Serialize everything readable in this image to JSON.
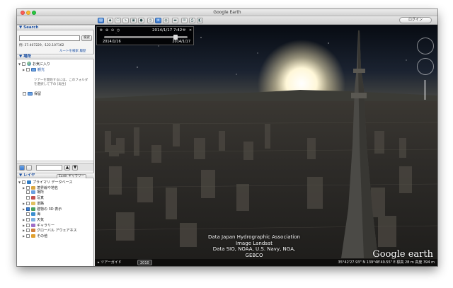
{
  "window": {
    "title": "Google Earth"
  },
  "toolbar": {
    "login_label": "ログイン"
  },
  "sidebar": {
    "search_title": "Search",
    "search_button": "検索",
    "coords": "例: 37.407229, -122.107162",
    "route_link": "ルートを検索",
    "history_link": "履歴",
    "places_title": "場所",
    "places": {
      "favorites": "お気に入り",
      "sightseeing": "観光",
      "hint": "ツアーを開始するには、このフォルダを選択して下の [再生]",
      "saved": "保留"
    },
    "layers_title": "レイヤ",
    "gallery_label": "Earth ギャラリー",
    "layers": [
      "プライマリ データベース",
      "境界線や地名",
      "場所",
      "写真",
      "道路",
      "建物の 3D 表示",
      "海",
      "天気",
      "ギャラリー",
      "グローバル アウェアネス",
      "その他"
    ],
    "layer_checked": [
      false,
      false,
      false,
      false,
      false,
      true,
      false,
      false,
      false,
      false,
      false
    ]
  },
  "time_slider": {
    "current": "2014/1/17   7:42",
    "start": "2014/1/16",
    "end": "2014/1/17",
    "position": 0.86
  },
  "map": {
    "attribution": [
      "Data Japan Hydrographic Association",
      "Image Landsat",
      "Data SIO, NOAA, U.S. Navy, NGA, GEBCO"
    ],
    "logo": "Google earth",
    "tour_label": "ツアーガイド",
    "year": "2010",
    "status": "35°42'27.93\" N   139°48'49.55\" E  標高   28 m    高度   394 m"
  }
}
